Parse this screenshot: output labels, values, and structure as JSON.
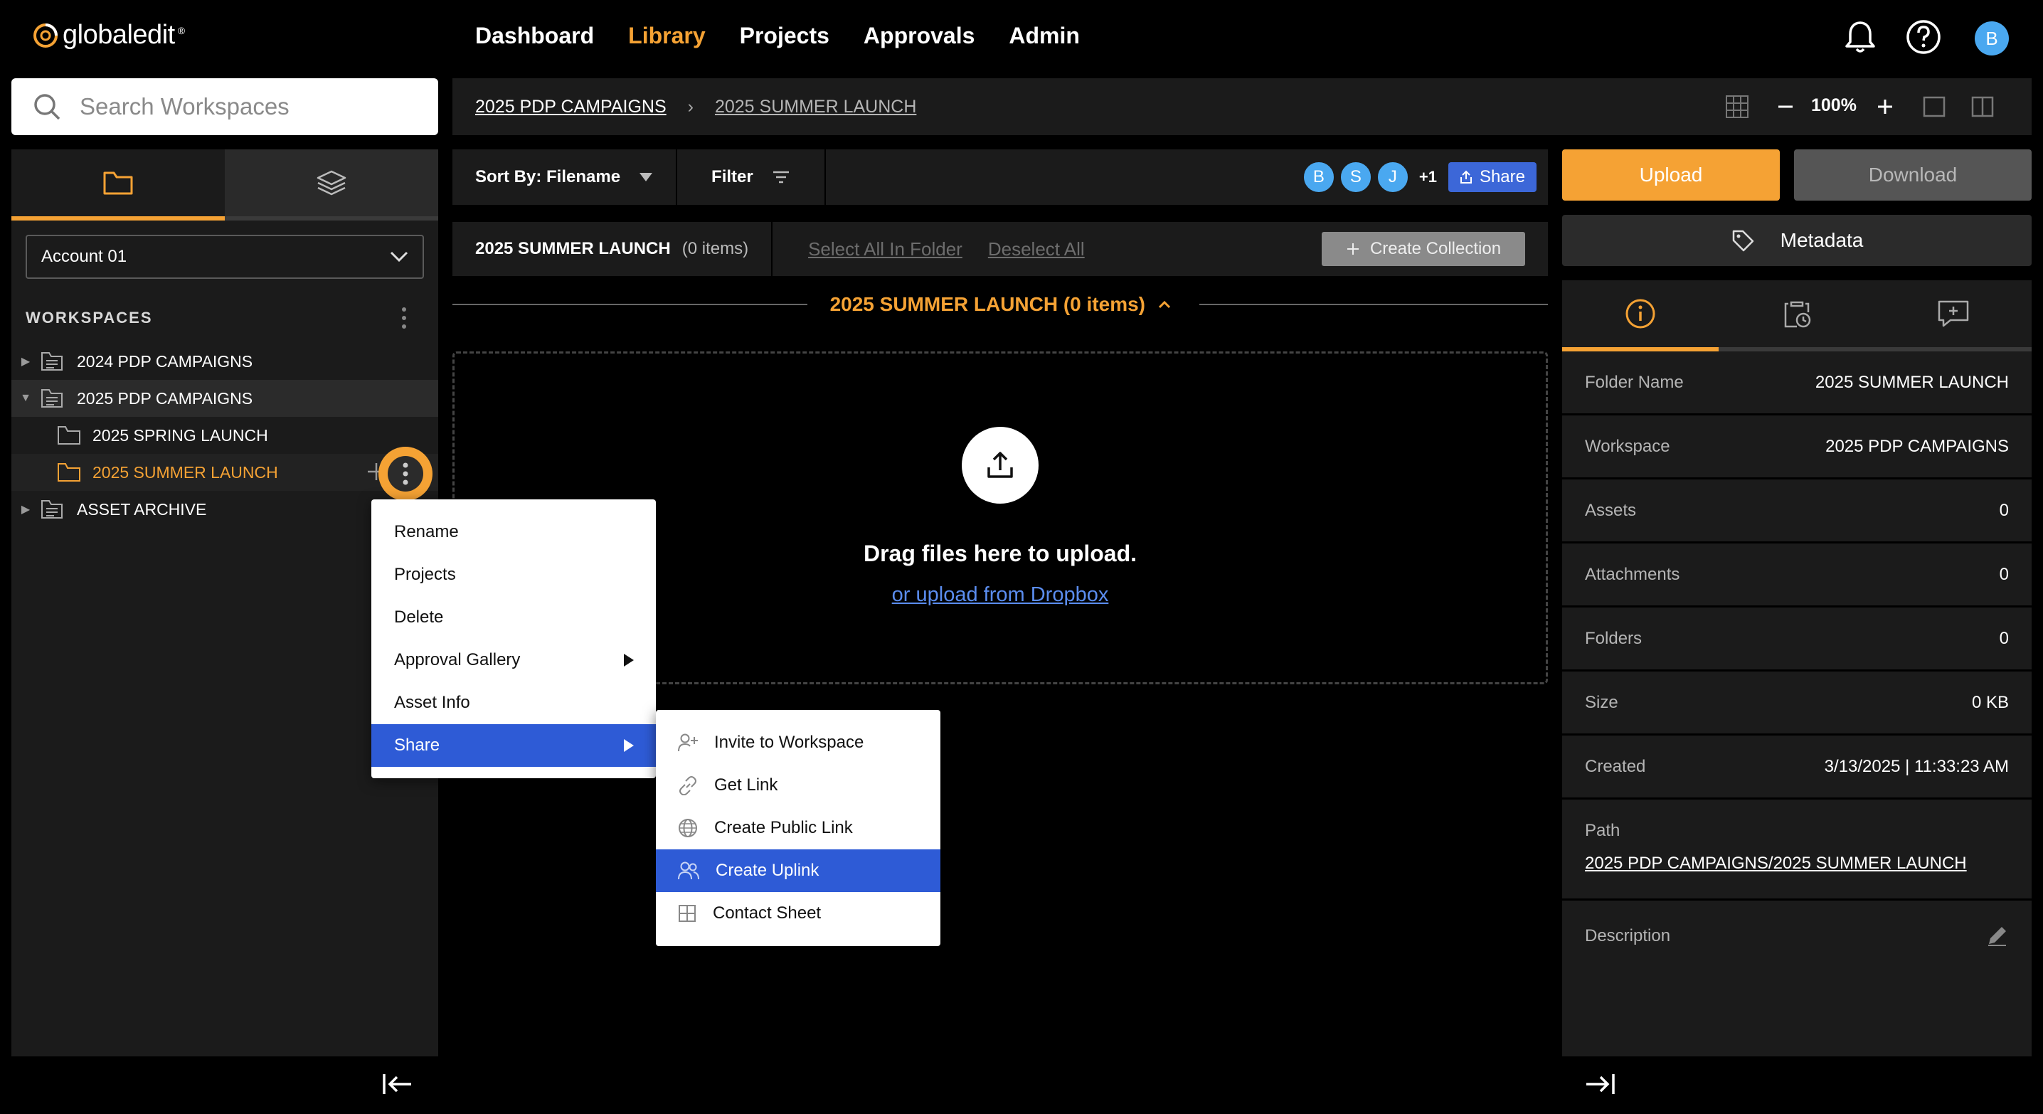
{
  "app": {
    "logo_text": "globaledit",
    "logo_mark": "®",
    "brand_color": "#f5a234"
  },
  "nav": {
    "items": [
      "Dashboard",
      "Library",
      "Projects",
      "Approvals",
      "Admin"
    ],
    "active": "Library"
  },
  "user": {
    "initial": "B"
  },
  "search": {
    "placeholder": "Search Workspaces"
  },
  "sidebar": {
    "account": "Account 01",
    "workspaces_header": "WORKSPACES",
    "tree": [
      {
        "label": "2024 PDP CAMPAIGNS"
      },
      {
        "label": "2025 PDP CAMPAIGNS"
      },
      {
        "label": "2025 SPRING LAUNCH"
      },
      {
        "label": "2025 SUMMER LAUNCH"
      },
      {
        "label": "ASSET ARCHIVE"
      }
    ]
  },
  "breadcrumb": {
    "items": [
      "2025 PDP CAMPAIGNS",
      "2025 SUMMER LAUNCH"
    ],
    "separator": "›"
  },
  "zoom": {
    "value": "100%"
  },
  "toolbar": {
    "sort_label": "Sort By: Filename",
    "filter_label": "Filter",
    "collaborators": [
      "B",
      "S",
      "J"
    ],
    "more_count": "+1",
    "share_label": "Share"
  },
  "folderbar": {
    "folder_name": "2025 SUMMER LAUNCH",
    "count": "(0 items)",
    "select_all": "Select All In Folder",
    "deselect_all": "Deselect All",
    "create_collection": "Create Collection"
  },
  "section": {
    "title": "2025 SUMMER LAUNCH (0 items)"
  },
  "dropzone": {
    "text": "Drag files here to upload.",
    "link": "or upload from Dropbox"
  },
  "actions": {
    "upload": "Upload",
    "download": "Download",
    "metadata": "Metadata"
  },
  "info": {
    "rows": [
      {
        "label": "Folder Name",
        "value": "2025 SUMMER LAUNCH"
      },
      {
        "label": "Workspace",
        "value": "2025 PDP CAMPAIGNS"
      },
      {
        "label": "Assets",
        "value": "0"
      },
      {
        "label": "Attachments",
        "value": "0"
      },
      {
        "label": "Folders",
        "value": "0"
      },
      {
        "label": "Size",
        "value": "0 KB"
      },
      {
        "label": "Created",
        "value": "3/13/2025 | 11:33:23 AM"
      }
    ],
    "path_label": "Path",
    "path_parts": [
      "2025 PDP CAMPAIGNS",
      "/",
      "2025 SUMMER LAUNCH"
    ],
    "description_label": "Description"
  },
  "context_menu": {
    "items": [
      "Rename",
      "Projects",
      "Delete",
      "Approval Gallery",
      "Asset Info",
      "Share"
    ],
    "selected": "Share"
  },
  "share_submenu": {
    "items": [
      {
        "label": "Invite to Workspace",
        "icon": "person-plus-icon"
      },
      {
        "label": "Get Link",
        "icon": "link-icon"
      },
      {
        "label": "Create Public Link",
        "icon": "globe-icon"
      },
      {
        "label": "Create Uplink",
        "icon": "people-icon"
      },
      {
        "label": "Contact Sheet",
        "icon": "grid-icon"
      }
    ],
    "selected": "Create Uplink"
  },
  "colors": {
    "accent": "#f5a234",
    "selection": "#2e5bd6",
    "avatar": "#4aa8f0",
    "link": "#5b8def"
  }
}
